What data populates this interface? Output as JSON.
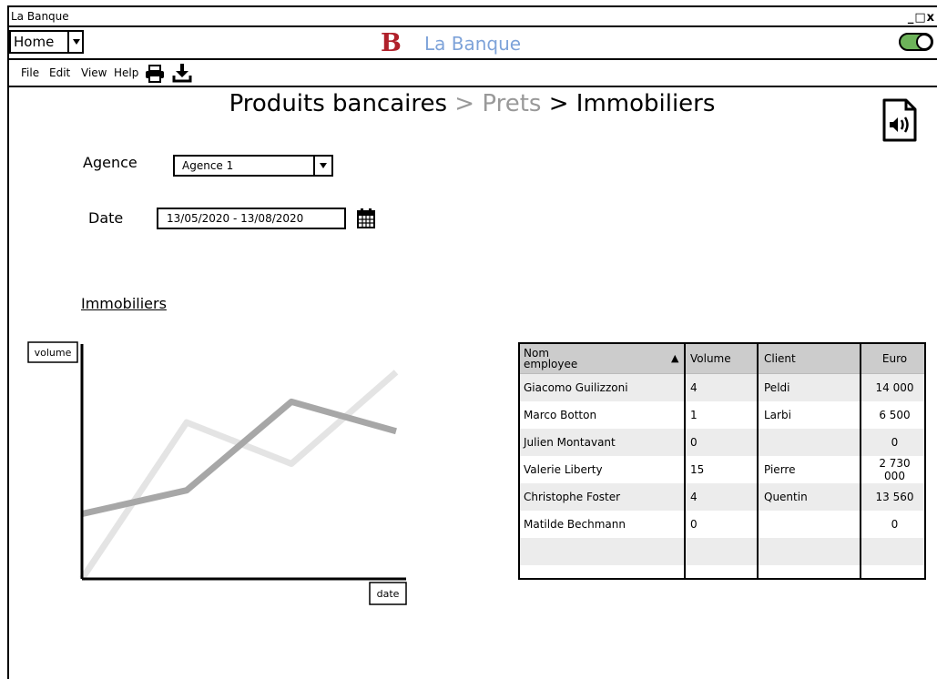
{
  "window": {
    "title": "La Banque",
    "controls": "_□x"
  },
  "nav": {
    "home_select": "Home",
    "brand_letter": "B",
    "brand_name": "La Banque",
    "toggle_state": "on",
    "toggle_color": "#6db35a"
  },
  "menu": {
    "items": [
      "File",
      "Edit",
      "View",
      "Help"
    ],
    "icons": [
      "printer-icon",
      "download-icon"
    ]
  },
  "breadcrumb": {
    "part1": "Produits bancaires",
    "sep1": " > ",
    "part2": "Prets",
    "sep2": " > ",
    "part3": "Immobiliers"
  },
  "form": {
    "agence_label": "Agence",
    "agence_value": "Agence 1",
    "date_label": "Date",
    "date_value": "13/05/2020 - 13/08/2020"
  },
  "section": {
    "title": "Immobiliers"
  },
  "chart_data": {
    "type": "line",
    "ylabel": "volume",
    "xlabel": "date",
    "series": [
      {
        "values": [
          0,
          5.3,
          3.9,
          7.0
        ],
        "color": "#e4e4e4"
      },
      {
        "values": [
          2.2,
          3.0,
          6.0,
          5.0
        ],
        "color": "#a7a7a7"
      }
    ],
    "ylim": [
      0,
      8.2
    ],
    "grid": false,
    "legend": "none"
  },
  "table": {
    "headers": [
      "Nom\nemployee",
      "Volume",
      "Client",
      "Euro"
    ],
    "rows": [
      [
        "Giacomo Guilizzoni",
        "4",
        "Peldi",
        "14 000"
      ],
      [
        "Marco Botton",
        "1",
        "Larbi",
        "6 500"
      ],
      [
        "Julien Montavant",
        "0",
        "",
        "0"
      ],
      [
        "Valerie Liberty",
        "15",
        "Pierre",
        "2 730 000"
      ],
      [
        "Christophe Foster",
        "4",
        "Quentin",
        "13 560"
      ],
      [
        "Matilde Bechmann",
        "0",
        "",
        "0"
      ],
      [
        "",
        "",
        "",
        ""
      ],
      [
        "",
        "",
        "",
        ""
      ]
    ]
  }
}
